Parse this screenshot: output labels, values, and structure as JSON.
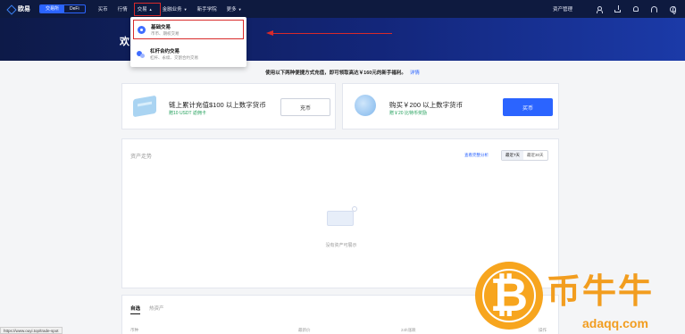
{
  "nav": {
    "brand": "欧易",
    "segments": [
      "交易所",
      "DeFi"
    ],
    "items": [
      {
        "label": "买币"
      },
      {
        "label": "行情"
      },
      {
        "label": "交易"
      },
      {
        "label": "金融业务"
      },
      {
        "label": "新手学院"
      },
      {
        "label": "更多"
      }
    ],
    "asset_mgmt": "资产管理"
  },
  "hero": {
    "title": "欢"
  },
  "dropdown": {
    "items": [
      {
        "title": "基础交易",
        "sub": "币币、期权交易"
      },
      {
        "title": "杠杆合约交易",
        "sub": "杠杆、永续、交割合约交易"
      }
    ]
  },
  "promo": {
    "text": "使用以下两种便捷方式充值，即可领取高达￥160元的新手福利。",
    "link": "详情"
  },
  "cards": [
    {
      "title": "链上累计充值$100 以上数字货币",
      "sub": "赠10 USDT 返佣卡",
      "button": "充币"
    },
    {
      "title": "购买￥200 以上数字货币",
      "sub": "赠￥20 比特币奖励",
      "button": "买币"
    }
  ],
  "trend": {
    "title": "资产走势",
    "link": "查看完整分析",
    "tabs": [
      "最近7天",
      "最近30天"
    ],
    "empty": "没有资产可展示"
  },
  "bottom": {
    "tabs": [
      "自选",
      "热资产"
    ],
    "columns": [
      "币种",
      "最新价",
      "24h涨跌",
      "操作"
    ]
  },
  "status_url": "https://www.ouyi.top/trade-spot",
  "watermark": {
    "text": "币牛牛",
    "url": "adaqq.com"
  },
  "colors": {
    "nav": "#0e1a3f",
    "accent": "#2b64ff",
    "highlight": "#d82a2a",
    "success": "#23a05b",
    "watermark": "#f29d1f"
  }
}
